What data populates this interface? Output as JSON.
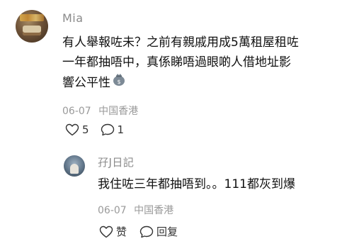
{
  "comments": [
    {
      "username": "Mia",
      "body_lines": [
        "有人舉報咗未？之前有親戚用成5萬租屋租咗",
        "一年都抽唔中，真係睇唔過眼啲人借地址影",
        "響公平性"
      ],
      "emoji_icon": "money-bag-emoji-icon",
      "date": "06-07",
      "location": "中国香港",
      "like_count": "5",
      "reply_count": "1"
    }
  ],
  "reply": {
    "username": "孖J日記",
    "body": "我住咗三年都抽唔到。。111都灰到爆",
    "date": "06-07",
    "location": "中国香港",
    "like_label": "赞",
    "reply_label": "回复"
  },
  "colors": {
    "meta_text": "#9a9a9a",
    "username_text": "#8a8a8a",
    "body_text": "#111111"
  }
}
